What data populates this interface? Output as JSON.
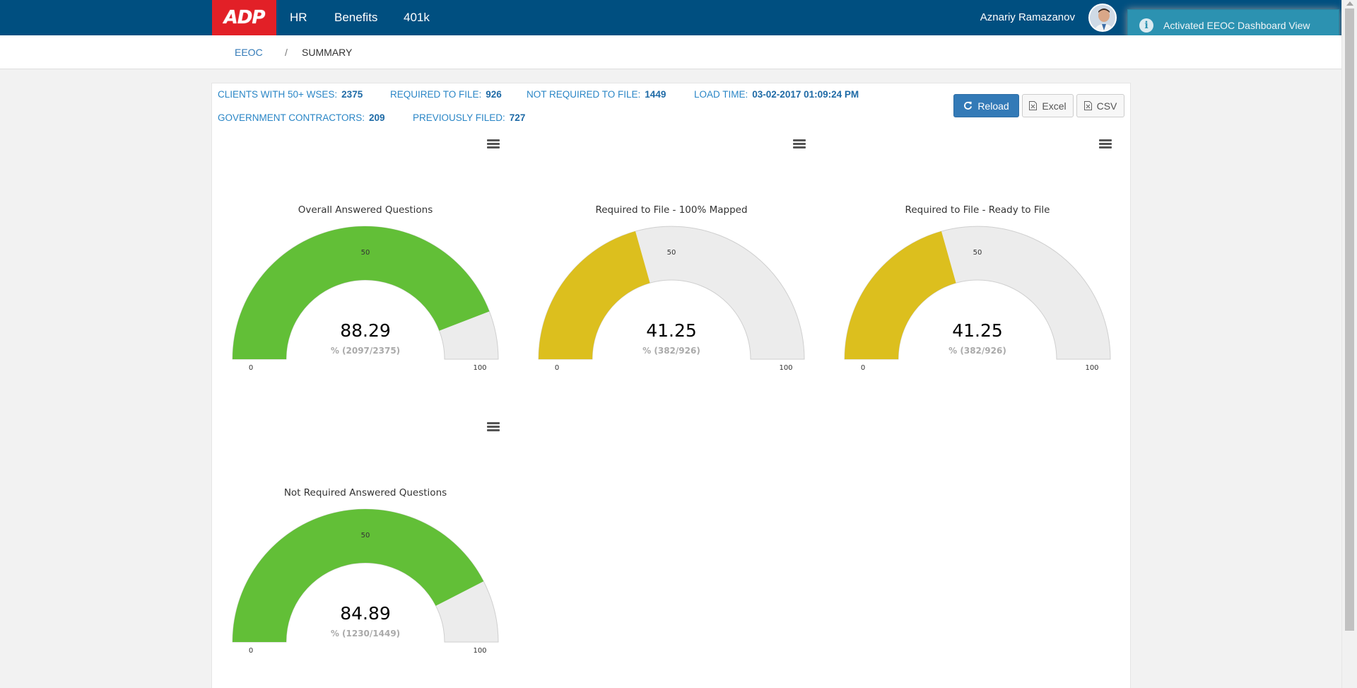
{
  "header": {
    "logo_text": "ADP",
    "nav": [
      "HR",
      "Benefits",
      "401k"
    ],
    "user_name": "Aznariy Ramazanov"
  },
  "toast": {
    "message": "Activated EEOC Dashboard View"
  },
  "breadcrumb": {
    "link": "EEOC",
    "separator": "/",
    "current": "SUMMARY"
  },
  "stats": {
    "clients_label": "CLIENTS WITH 50+ WSES:",
    "clients_value": "2375",
    "required_label": "REQUIRED TO FILE:",
    "required_value": "926",
    "not_required_label": "NOT REQUIRED TO FILE:",
    "not_required_value": "1449",
    "load_time_label": "LOAD TIME:",
    "load_time_value": "03-02-2017 01:09:24 PM",
    "gov_label": "GOVERNMENT CONTRACTORS:",
    "gov_value": "209",
    "prev_label": "PREVIOUSLY FILED:",
    "prev_value": "727"
  },
  "buttons": {
    "reload": "Reload",
    "excel": "Excel",
    "csv": "CSV"
  },
  "colors": {
    "green": "#62bf37",
    "yellow": "#dcbf1e",
    "empty": "#ececec",
    "header": "#004f80",
    "logo": "#e22027"
  },
  "chart_data": [
    {
      "type": "gauge",
      "title": "Overall Answered Questions",
      "value": 88.29,
      "display_value": "88.29",
      "subtitle": "% (2097/2375)",
      "min": 0,
      "max": 100,
      "mid_label": "50",
      "min_label": "0",
      "max_label": "100",
      "color": "#62bf37"
    },
    {
      "type": "gauge",
      "title": "Required to File - 100% Mapped",
      "value": 41.25,
      "display_value": "41.25",
      "subtitle": "% (382/926)",
      "min": 0,
      "max": 100,
      "mid_label": "50",
      "min_label": "0",
      "max_label": "100",
      "color": "#dcbf1e"
    },
    {
      "type": "gauge",
      "title": "Required to File - Ready to File",
      "value": 41.25,
      "display_value": "41.25",
      "subtitle": "% (382/926)",
      "min": 0,
      "max": 100,
      "mid_label": "50",
      "min_label": "0",
      "max_label": "100",
      "color": "#dcbf1e"
    },
    {
      "type": "gauge",
      "title": "Not Required Answered Questions",
      "value": 84.89,
      "display_value": "84.89",
      "subtitle": "% (1230/1449)",
      "min": 0,
      "max": 100,
      "mid_label": "50",
      "min_label": "0",
      "max_label": "100",
      "color": "#62bf37"
    }
  ]
}
